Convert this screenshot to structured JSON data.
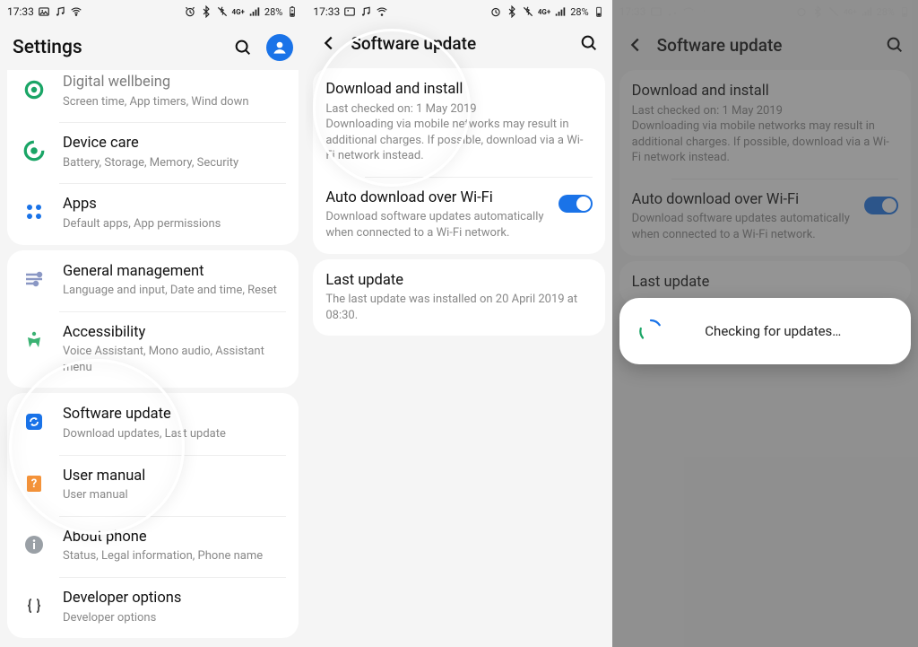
{
  "status": {
    "time": "17:33",
    "battery_text": "28%"
  },
  "screen1": {
    "title": "Settings",
    "groups": {
      "g0": {
        "wellbeing": {
          "title": "Digital wellbeing",
          "sub": "Screen time, App timers, Wind down"
        },
        "devicecare": {
          "title": "Device care",
          "sub": "Battery, Storage, Memory, Security"
        },
        "apps": {
          "title": "Apps",
          "sub": "Default apps, App permissions"
        }
      },
      "g1": {
        "genmgmt": {
          "title": "General management",
          "sub": "Language and input, Date and time, Reset"
        },
        "a11y": {
          "title": "Accessibility",
          "sub": "Voice Assistant, Mono audio, Assistant menu"
        }
      },
      "g2": {
        "swupdate": {
          "title": "Software update",
          "sub": "Download updates, Last update"
        },
        "usermanual": {
          "title": "User manual",
          "sub": "User manual"
        },
        "about": {
          "title": "About phone",
          "sub": "Status, Legal information, Phone name"
        },
        "developer": {
          "title": "Developer options",
          "sub": "Developer options"
        }
      }
    }
  },
  "screen2": {
    "title": "Software update",
    "download": {
      "title": "Download and install",
      "sub": "Last checked on: 1 May 2019\nDownloading via mobile networks may result in additional charges. If possible, download via a Wi-Fi network instead."
    },
    "autodl": {
      "title": "Auto download over Wi-Fi",
      "sub": "Download software updates automatically when connected to a Wi-Fi network."
    },
    "lastupdate": {
      "title": "Last update",
      "sub": "The last update was installed on 20 April 2019 at 08:30."
    }
  },
  "screen3": {
    "dialog_text": "Checking for updates…"
  }
}
